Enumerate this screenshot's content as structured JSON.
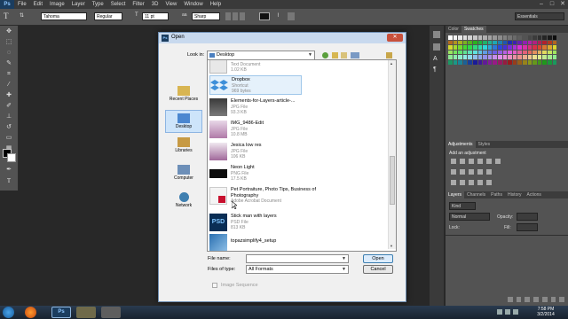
{
  "menubar": {
    "logo": "Ps",
    "items": [
      "File",
      "Edit",
      "Image",
      "Layer",
      "Type",
      "Select",
      "Filter",
      "3D",
      "View",
      "Window",
      "Help"
    ],
    "window_controls": [
      "–",
      "□",
      "✕"
    ]
  },
  "options": {
    "font_family": "Tahoma",
    "font_style": "Regular",
    "font_size": "11 pt",
    "antialias": "Sharp",
    "workspace": "Essentials"
  },
  "panels": {
    "color_tabs": [
      "Color",
      "Swatches"
    ],
    "adjust_tabs": [
      "Adjustments",
      "Styles"
    ],
    "adjust_title": "Add an adjustment",
    "layers_tabs": [
      "Layers",
      "Channels",
      "Paths",
      "History",
      "Actions"
    ],
    "layers_kind": "Kind",
    "blend_mode": "Normal",
    "opacity_label": "Opacity:",
    "lock_label": "Lock:",
    "fill_label": "Fill:"
  },
  "dialog": {
    "title": "Open",
    "close": "✕",
    "look_in_label": "Look in:",
    "look_in_value": "Desktop",
    "places": [
      {
        "label": "Recent Places",
        "icon": "recent-places-icon"
      },
      {
        "label": "Desktop",
        "icon": "desktop-icon"
      },
      {
        "label": "Libraries",
        "icon": "libraries-icon"
      },
      {
        "label": "Computer",
        "icon": "computer-icon"
      },
      {
        "label": "Network",
        "icon": "network-icon"
      }
    ],
    "files": [
      {
        "name": "",
        "type": "Text Document",
        "size": "1.02 KB",
        "icon": "text-document-icon"
      },
      {
        "name": "Dropbox",
        "type": "Shortcut",
        "size": "969 bytes",
        "icon": "dropbox-icon"
      },
      {
        "name": "Elements-for-Layers-article-...",
        "type": "JPG File",
        "size": "93.3 KB",
        "icon": "jpg-thumb-icon"
      },
      {
        "name": "IMG_9486-Edit",
        "type": "JPG File",
        "size": "10.8 MB",
        "icon": "jpg-thumb-icon"
      },
      {
        "name": "Jesica low res",
        "type": "JPG File",
        "size": "106 KB",
        "icon": "jpg-thumb-icon"
      },
      {
        "name": "Neon Light",
        "type": "PNG File",
        "size": "17.5 KB",
        "icon": "png-thumb-icon"
      },
      {
        "name": "Pet Portraiture, Photo Tips, Business of Photography",
        "type": "Adobe Acrobat Document",
        "size": "",
        "icon": "pdf-icon"
      },
      {
        "name": "Stick man with layers",
        "type": "PSD File",
        "size": "813 KB",
        "icon": "psd-icon"
      },
      {
        "name": "topazsimplify4_setup",
        "type": "",
        "size": "",
        "icon": "installer-icon"
      }
    ],
    "file_name_label": "File name:",
    "file_name_value": "",
    "file_type_label": "Files of type:",
    "file_type_value": "All Formats",
    "open_label": "Open",
    "cancel_label": "Cancel",
    "image_sequence_label": "Image Sequence"
  },
  "taskbar": {
    "time": "7:58 PM",
    "date": "3/2/2014"
  }
}
